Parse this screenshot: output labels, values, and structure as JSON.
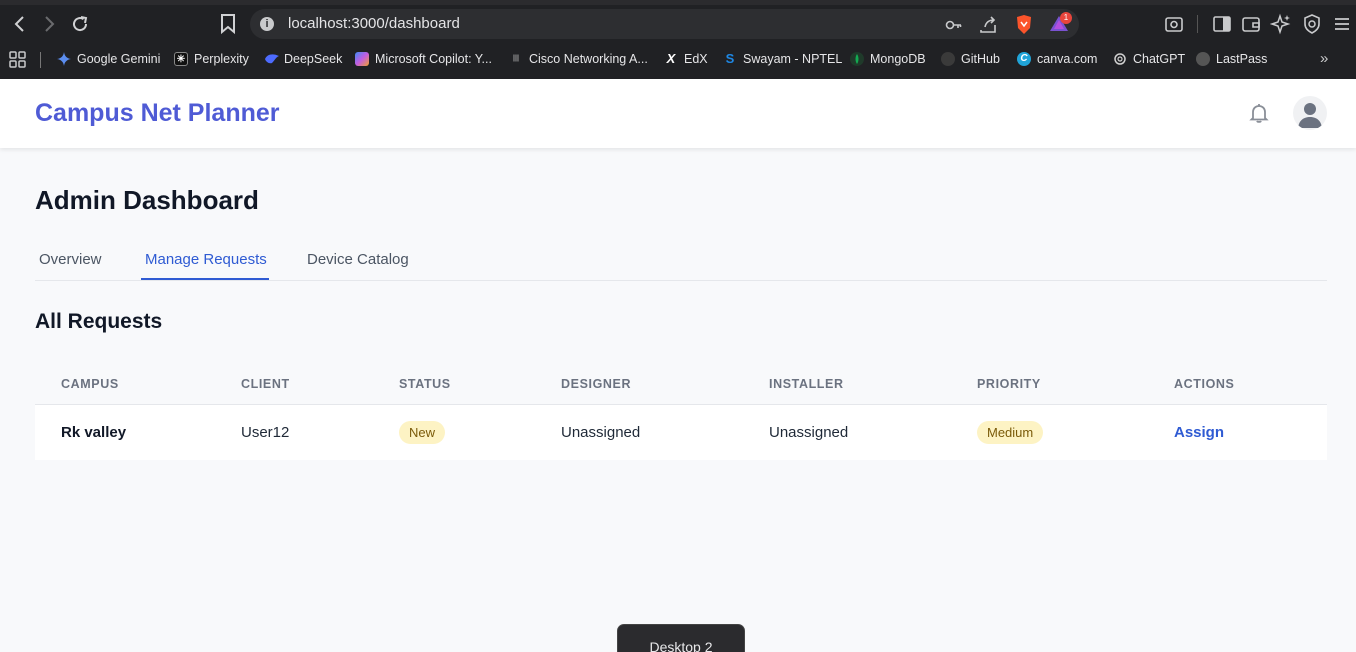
{
  "browser": {
    "url": "localhost:3000/dashboard",
    "notification_count": "1",
    "bookmarks": [
      {
        "label": "Google Gemini",
        "icon": "gemini-icon",
        "color": "#5b8def"
      },
      {
        "label": "Perplexity",
        "icon": "perplexity-icon",
        "color": "#222222"
      },
      {
        "label": "DeepSeek",
        "icon": "deepseek-icon",
        "color": "#4d6bfe"
      },
      {
        "label": "Microsoft Copilot: Y...",
        "icon": "copilot-icon",
        "color": "#c45de0"
      },
      {
        "label": "Cisco Networking A...",
        "icon": "cisco-icon",
        "color": "#555555"
      },
      {
        "label": "EdX",
        "icon": "edx-icon",
        "color": "#1c1c1c"
      },
      {
        "label": "Swayam - NPTEL",
        "icon": "swayam-icon",
        "color": "#1e88e5"
      },
      {
        "label": "MongoDB",
        "icon": "mongodb-icon",
        "color": "#1f6f3a"
      },
      {
        "label": "GitHub",
        "icon": "github-icon",
        "color": "#3a3a3a"
      },
      {
        "label": "canva.com",
        "icon": "canva-icon",
        "color": "#20a4d8"
      },
      {
        "label": "ChatGPT",
        "icon": "chatgpt-icon",
        "color": "#3a3a3a"
      },
      {
        "label": "LastPass",
        "icon": "lastpass-icon",
        "color": "#666666"
      }
    ]
  },
  "app": {
    "brand": "Campus Net Planner",
    "brand_color": "#4f5bd5"
  },
  "main": {
    "title": "Admin Dashboard",
    "tabs": [
      {
        "label": "Overview",
        "active": false
      },
      {
        "label": "Manage Requests",
        "active": true
      },
      {
        "label": "Device Catalog",
        "active": false
      }
    ],
    "section_title": "All Requests",
    "table": {
      "columns": [
        "CAMPUS",
        "CLIENT",
        "STATUS",
        "DESIGNER",
        "INSTALLER",
        "PRIORITY",
        "ACTIONS"
      ],
      "rows": [
        {
          "campus": "Rk valley",
          "client": "User12",
          "status": "New",
          "designer": "Unassigned",
          "installer": "Unassigned",
          "priority": "Medium",
          "action": "Assign"
        }
      ]
    }
  },
  "os": {
    "desktop_label": "Desktop 2"
  },
  "colors": {
    "accent": "#2f5bd3",
    "badge_bg": "#fdf3c4"
  }
}
